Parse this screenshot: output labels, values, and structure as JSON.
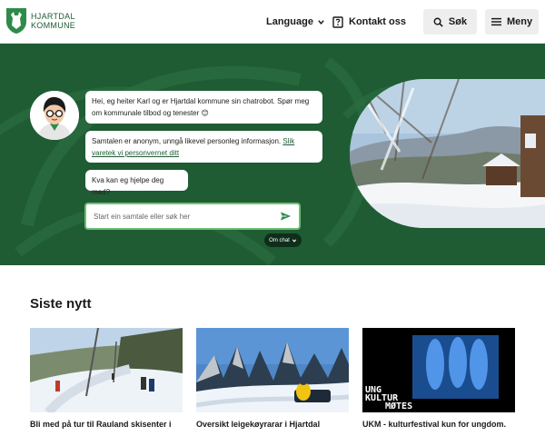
{
  "header": {
    "logo_line1": "HJARTDAL",
    "logo_line2": "KOMMUNE",
    "language_label": "Language",
    "contact_label": "Kontakt oss",
    "search_label": "Søk",
    "menu_label": "Meny"
  },
  "chat": {
    "bubble1": "Hei, eg heiter Karl og er Hjartdal kommune sin chatrobot. Spør meg om kommunale tilbod og tenester 😊",
    "bubble2_text": "Samtalen er anonym, unngå likevel personleg informasjon. ",
    "bubble2_link": "Slik varetek vi personvernet ditt",
    "bubble3": "Kva kan eg hjelpe deg med?",
    "input_placeholder": "Start ein samtale eller søk her",
    "om_chat_label": "Om chat"
  },
  "news": {
    "heading": "Siste nytt",
    "items": [
      {
        "title": "Bli med på tur til Rauland skisenter i"
      },
      {
        "title": "Oversikt leigekøyrarar i Hjartdal"
      },
      {
        "title": "UKM - kulturfestival kun for ungdom."
      }
    ],
    "ukm_line1": "UNG",
    "ukm_line2": "KULTUR",
    "ukm_line3": "MØTES"
  },
  "colors": {
    "brand_green": "#1f5c34",
    "accent_green": "#6fbf73",
    "button_grey": "#eeeeee"
  }
}
